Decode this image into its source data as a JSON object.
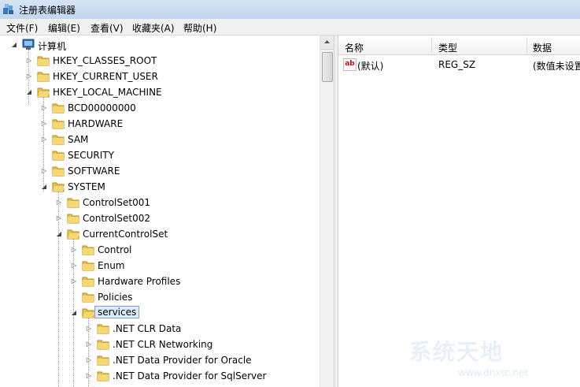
{
  "window": {
    "title": "注册表编辑器"
  },
  "menu": [
    "文件(F)",
    "编辑(E)",
    "查看(V)",
    "收藏夹(A)",
    "帮助(H)"
  ],
  "tree": {
    "root": "计算机",
    "nodes": [
      {
        "label": "HKEY_CLASSES_ROOT"
      },
      {
        "label": "HKEY_CURRENT_USER"
      },
      {
        "label": "HKEY_LOCAL_MACHINE"
      },
      {
        "label": "BCD00000000"
      },
      {
        "label": "HARDWARE"
      },
      {
        "label": "SAM"
      },
      {
        "label": "SECURITY"
      },
      {
        "label": "SOFTWARE"
      },
      {
        "label": "SYSTEM"
      },
      {
        "label": "ControlSet001"
      },
      {
        "label": "ControlSet002"
      },
      {
        "label": "CurrentControlSet"
      },
      {
        "label": "Control"
      },
      {
        "label": "Enum"
      },
      {
        "label": "Hardware Profiles"
      },
      {
        "label": "Policies"
      },
      {
        "label": "services"
      },
      {
        "label": ".NET CLR Data"
      },
      {
        "label": ".NET CLR Networking"
      },
      {
        "label": ".NET Data Provider for Oracle"
      },
      {
        "label": ".NET Data Provider for SqlServer"
      }
    ],
    "selected": "services"
  },
  "list": {
    "columns": [
      "名称",
      "类型",
      "数据"
    ],
    "rows": [
      {
        "name": "(默认)",
        "type": "REG_SZ",
        "data": "(数值未设置"
      }
    ]
  },
  "watermark": {
    "text": "系统天地",
    "url": "www.dnxtc.net"
  },
  "colors": {
    "selection_bg": "#dcecfc",
    "selection_border": "#7da2ce",
    "folder": "#e8c24a"
  }
}
